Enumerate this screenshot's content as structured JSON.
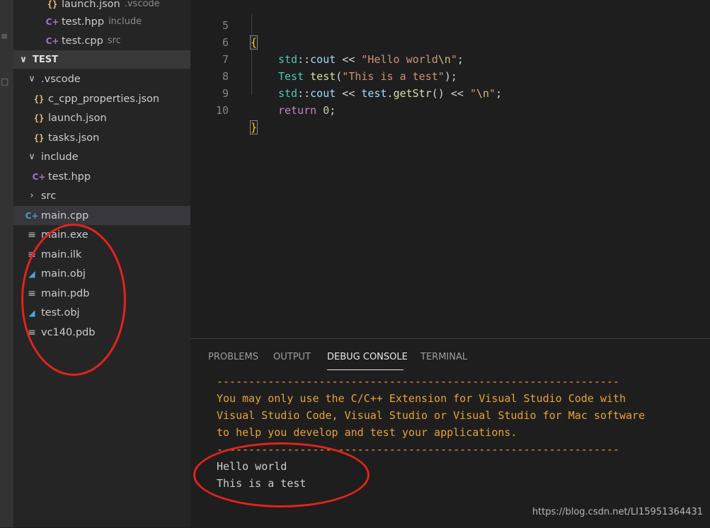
{
  "sidebar": {
    "top_items": [
      {
        "label": "launch.json",
        "desc": ".vscode"
      },
      {
        "label": "test.hpp",
        "desc": "include"
      },
      {
        "label": "test.cpp",
        "desc": "src"
      }
    ],
    "section_title": "TEST",
    "tree": [
      {
        "label": ".vscode"
      },
      {
        "label": "c_cpp_properties.json"
      },
      {
        "label": "launch.json"
      },
      {
        "label": "tasks.json"
      },
      {
        "label": "include"
      },
      {
        "label": "test.hpp"
      },
      {
        "label": "src"
      },
      {
        "label": "main.cpp"
      },
      {
        "label": "main.exe"
      },
      {
        "label": "main.ilk"
      },
      {
        "label": "main.obj"
      },
      {
        "label": "main.pdb"
      },
      {
        "label": "test.obj"
      },
      {
        "label": "vc140.pdb"
      }
    ]
  },
  "editor": {
    "line_numbers": [
      "5",
      "6",
      "7",
      "8",
      "9",
      "10"
    ],
    "l5": {
      "brace": "{"
    },
    "l6": {
      "ns": "std",
      "sep": "::",
      "id": "cout",
      "op": " << ",
      "str1": "\"Hello world",
      "esc": "\\n",
      "str2": "\"",
      "end": ";"
    },
    "l7": {
      "type": "Test",
      "var": "test",
      "open": "(",
      "str": "\"This is a test\"",
      "close": ");"
    },
    "l8": {
      "ns": "std",
      "sep": "::",
      "id": "cout",
      "op1": " << ",
      "obj": "test",
      "dot": ".",
      "fn": "getStr",
      "call": "()",
      "op2": " << ",
      "str1": "\"",
      "esc": "\\n",
      "str2": "\"",
      "end": ";"
    },
    "l9": {
      "kw": "return",
      "num": "0",
      "end": ";"
    },
    "l10": {
      "brace": "}"
    }
  },
  "panel": {
    "tabs": [
      "PROBLEMS",
      "OUTPUT",
      "DEBUG CONSOLE",
      "TERMINAL"
    ],
    "active_tab": "DEBUG CONSOLE",
    "lines": [
      "---------------------------------------------------------------",
      "You may only use the C/C++ Extension for Visual Studio Code with",
      "Visual Studio Code, Visual Studio or Visual Studio for Mac software",
      "to help you develop and test your applications.",
      "---------------------------------------------------------------",
      "Hello world",
      "This is a test"
    ]
  },
  "watermark": "https://blog.csdn.net/LI15951364431",
  "colors": {
    "accent_annotation": "#e3231b",
    "warning_text": "#e9a23b",
    "selected_row": "#37373d"
  },
  "icons": [
    "json-icon",
    "cpp-file-icon",
    "text-file-icon",
    "obj-file-icon",
    "chevron-down-icon",
    "chevron-right-icon"
  ]
}
